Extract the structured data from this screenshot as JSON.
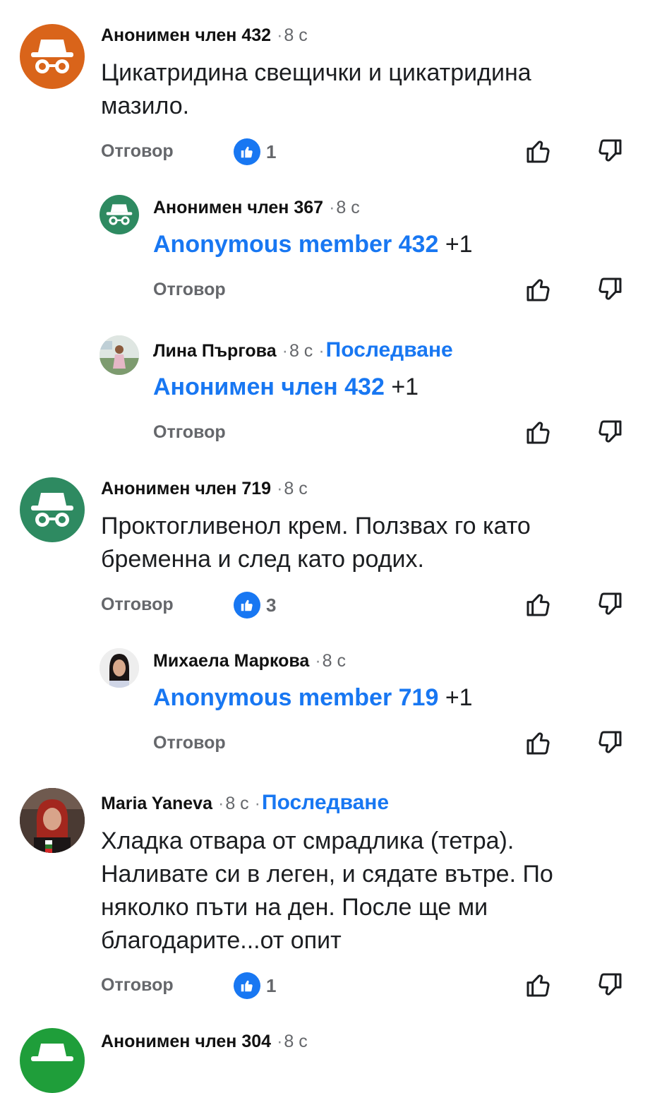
{
  "comments": [
    {
      "name": "Анонимен член 432",
      "time": "8 с",
      "text": "Цикатридина свещички и цикатридина мазило.",
      "reply": "Отговор",
      "likes": "1"
    },
    {
      "name": "Анонимен член 367",
      "time": "8 с",
      "mention": "Anonymous member 432",
      "suffix": "+1",
      "reply": "Отговор"
    },
    {
      "name": "Лина Пъргова",
      "time": "8 с",
      "follow": "Последване",
      "mention": "Анонимен член 432",
      "suffix": "+1",
      "reply": "Отговор"
    },
    {
      "name": "Анонимен член 719",
      "time": "8 с",
      "text": "Проктогливенол крем. Ползвах го като бременна и след като родих.",
      "reply": "Отговор",
      "likes": "3"
    },
    {
      "name": "Михаела Маркова",
      "time": "8 с",
      "mention": "Anonymous member 719",
      "suffix": "+1",
      "reply": "Отговор"
    },
    {
      "name": "Maria Yaneva",
      "time": "8 с",
      "follow": "Последване",
      "text": "Хладка отвара от смрадлика (тетра). Наливате си в леген, и сядате вътре. По няколко пъти на ден. После ще ми благодарите...от опит",
      "reply": "Отговор",
      "likes": "1"
    },
    {
      "name": "Анонимен член 304",
      "time": "8 с"
    }
  ],
  "separator": "·",
  "icons": {
    "anonymous": "incognito-icon",
    "like": "thumbs-up-icon",
    "dislike": "thumbs-down-icon",
    "reaction": "like-reaction-icon"
  },
  "colors": {
    "accent": "#1877f2",
    "avatar_orange": "#d9641a",
    "avatar_green": "#2e8a61",
    "avatar_green2": "#1f9e3a"
  }
}
